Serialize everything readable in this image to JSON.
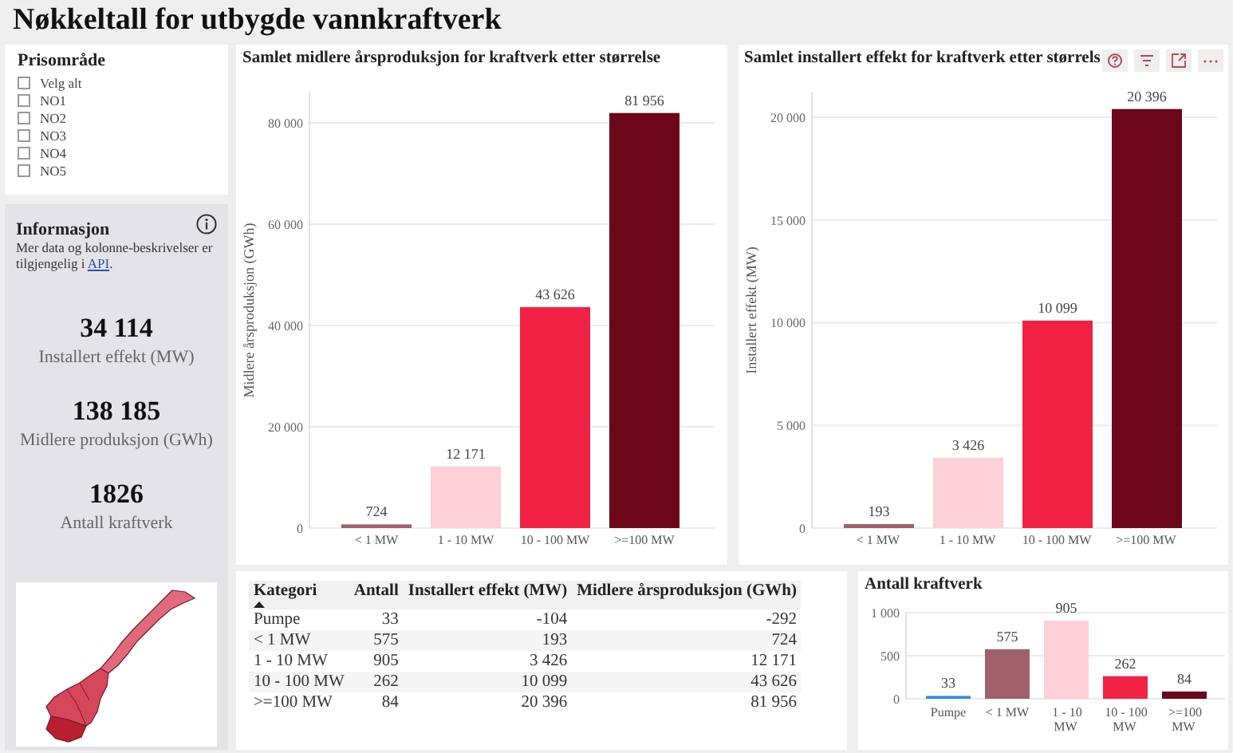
{
  "title": "Nøkkeltall for utbygde vannkraftverk",
  "slicer": {
    "title": "Prisområde",
    "items": [
      {
        "label": "Velg alt",
        "checked": false
      },
      {
        "label": "NO1",
        "checked": false
      },
      {
        "label": "NO2",
        "checked": false
      },
      {
        "label": "NO3",
        "checked": false
      },
      {
        "label": "NO4",
        "checked": false
      },
      {
        "label": "NO5",
        "checked": false
      }
    ]
  },
  "info": {
    "title": "Informasjon",
    "text": "Mer data og kolonne-beskrivelser er tilgjengelig i ",
    "link": "API",
    "after": "."
  },
  "kpis": [
    {
      "value": "34 114",
      "label": "Installert effekt (MW)"
    },
    {
      "value": "138 185",
      "label": "Midlere produksjon (GWh)"
    },
    {
      "value": "1826",
      "label": "Antall kraftverk"
    }
  ],
  "production_chart": {
    "hovered": false,
    "bars": [
      {
        "color": "#a0616a"
      },
      {
        "color": "#fdd0d8"
      },
      {
        "color": "#f12244"
      },
      {
        "color": "#6b0719"
      }
    ],
    "chart_data": {
      "type": "bar",
      "title": "Samlet midlere årsproduksjon for kraftverk etter størrelse",
      "ylabel": "Midlere årsproduksjon (GWh)",
      "categories": [
        "< 1 MW",
        "1 - 10 MW",
        "10 - 100 MW",
        ">=100 MW"
      ],
      "series": [
        {
          "values": [
            724,
            12171,
            43626,
            81956
          ]
        }
      ],
      "ylim": [
        0,
        86000
      ],
      "yticks": [
        {
          "value": 0,
          "label": "0"
        },
        {
          "value": 20000,
          "label": "20 000"
        },
        {
          "value": 40000,
          "label": "40 000"
        },
        {
          "value": 60000,
          "label": "60 000"
        },
        {
          "value": 80000,
          "label": "80 000"
        }
      ],
      "grid": true,
      "value_labels": [
        "724",
        "12 171",
        "43 626",
        "81 956"
      ]
    }
  },
  "capacity_chart": {
    "hovered": true,
    "bars": [
      {
        "color": "#a0616a"
      },
      {
        "color": "#fdd0d8"
      },
      {
        "color": "#f12244"
      },
      {
        "color": "#6b0719"
      }
    ],
    "chart_data": {
      "type": "bar",
      "title": "Samlet installert effekt for kraftverk etter størrels",
      "ylabel": "Installert effekt (MW)",
      "categories": [
        "< 1 MW",
        "1 - 10 MW",
        "10 - 100 MW",
        ">=100 MW"
      ],
      "series": [
        {
          "values": [
            193,
            3426,
            10099,
            20396
          ]
        }
      ],
      "ylim": [
        0,
        21200
      ],
      "yticks": [
        {
          "value": 0,
          "label": "0"
        },
        {
          "value": 5000,
          "label": "5 000"
        },
        {
          "value": 10000,
          "label": "10 000"
        },
        {
          "value": 15000,
          "label": "15 000"
        },
        {
          "value": 20000,
          "label": "20 000"
        }
      ],
      "grid": true,
      "value_labels": [
        "193",
        "3 426",
        "10 099",
        "20 396"
      ]
    }
  },
  "table": {
    "columns": [
      {
        "label": "Kategori",
        "sorted": true
      },
      {
        "label": "Antall",
        "sorted": false
      },
      {
        "label": "Installert effekt (MW)",
        "sorted": false
      },
      {
        "label": "Midlere årsproduksjon (GWh)",
        "sorted": false
      }
    ],
    "rows": [
      [
        "Pumpe",
        "33",
        "-104",
        "-292"
      ],
      [
        "< 1 MW",
        "575",
        "193",
        "724"
      ],
      [
        "1 - 10 MW",
        "905",
        "3 426",
        "12 171"
      ],
      [
        "10 - 100 MW",
        "262",
        "10 099",
        "43 626"
      ],
      [
        ">=100 MW",
        "84",
        "20 396",
        "81 956"
      ]
    ]
  },
  "count_chart": {
    "hovered": false,
    "bars": [
      {
        "color": "#2e8de8"
      },
      {
        "color": "#a0616a"
      },
      {
        "color": "#fdd0d8"
      },
      {
        "color": "#f12244"
      },
      {
        "color": "#6b0719"
      }
    ],
    "chart_data": {
      "type": "bar",
      "title": "Antall kraftverk",
      "categories": [
        "Pumpe",
        "< 1 MW",
        "1 - 10 MW",
        "10 - 100 MW",
        ">=100 MW"
      ],
      "series": [
        {
          "values": [
            33,
            575,
            905,
            262,
            84
          ]
        }
      ],
      "ylim": [
        0,
        1000
      ],
      "yticks": [
        {
          "value": 0,
          "label": "0"
        },
        {
          "value": 500,
          "label": "500"
        },
        {
          "value": 1000,
          "label": "1 000"
        }
      ],
      "grid": true,
      "value_labels": [
        "33",
        "575",
        "905",
        "262",
        "84"
      ]
    }
  }
}
